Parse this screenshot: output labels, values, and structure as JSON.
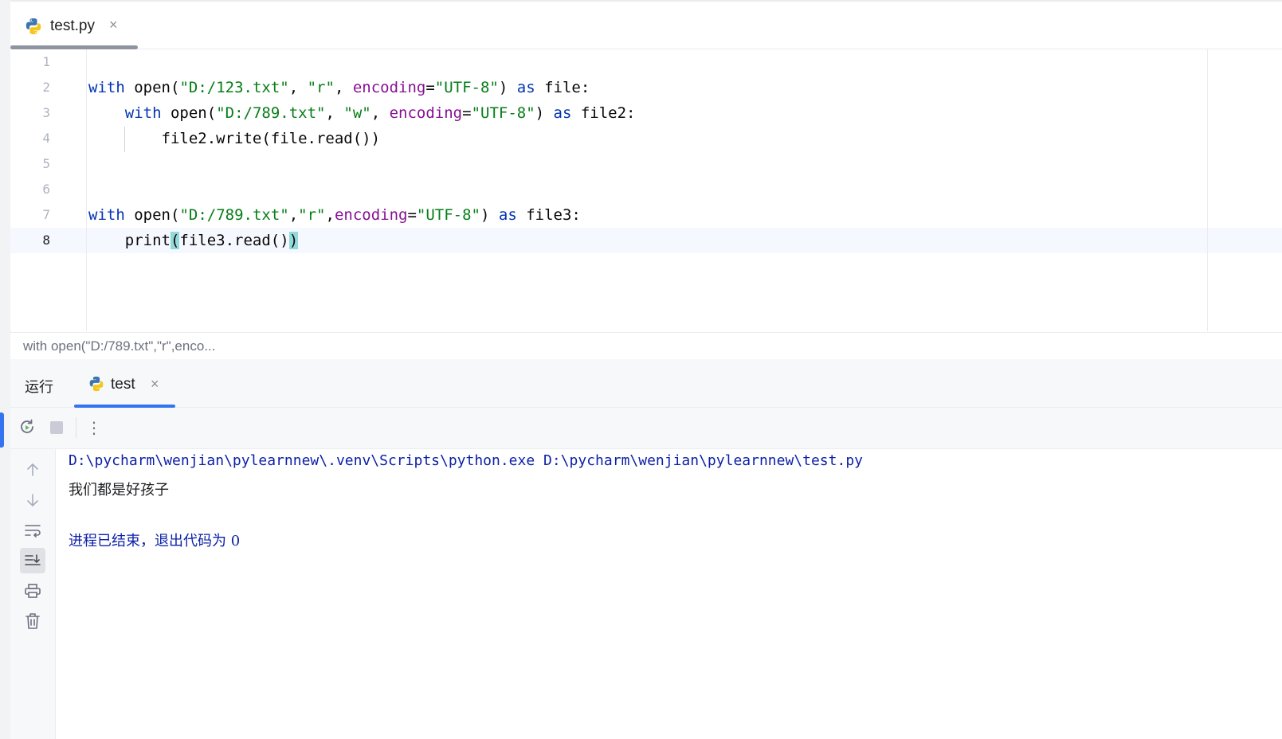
{
  "editor_tab": {
    "filename": "test.py",
    "close": "×"
  },
  "code": {
    "line_numbers": [
      "1",
      "2",
      "3",
      "4",
      "5",
      "6",
      "7",
      "8"
    ],
    "active_line": "8"
  },
  "breadcrumb": "with open(\"D:/789.txt\",\"r\",enco...",
  "run_panel": {
    "title": "运行",
    "tab_label": "test",
    "tab_close": "×",
    "more_icon": "⋮"
  },
  "console": {
    "command": "D:\\pycharm\\wenjian\\pylearnnew\\.venv\\Scripts\\python.exe D:\\pycharm\\wenjian\\pylearnnew\\test.py",
    "output": "我们都是好孩子",
    "exit_message": "进程已结束，退出代码为 0"
  },
  "icons": {
    "tab_file": "python-icon",
    "rerun": "rerun-icon",
    "stop": "stop-icon",
    "up": "arrow-up-icon",
    "down": "arrow-down-icon",
    "wrap": "soft-wrap-icon",
    "scroll_end": "scroll-to-end-icon",
    "print": "print-icon",
    "trash": "trash-icon"
  },
  "colors": {
    "keyword": "#0033b3",
    "string": "#067d17",
    "parameter": "#871094",
    "accent": "#3574f0",
    "console_text": "#0b1fa8"
  }
}
